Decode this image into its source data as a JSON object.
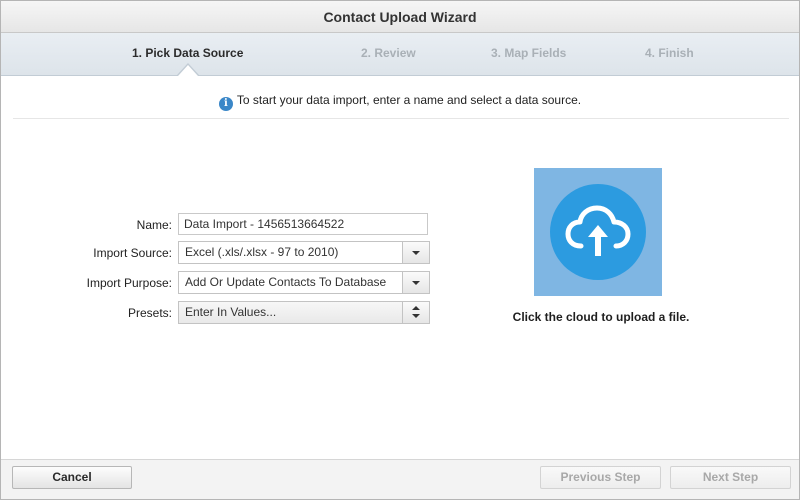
{
  "window": {
    "title": "Contact Upload Wizard"
  },
  "wizard": {
    "steps": [
      {
        "label": "1. Pick Data Source",
        "state": "active"
      },
      {
        "label": "2. Review",
        "state": "inactive"
      },
      {
        "label": "3. Map Fields",
        "state": "inactive"
      },
      {
        "label": "4. Finish",
        "state": "inactive"
      }
    ]
  },
  "info": {
    "icon": "info-icon",
    "text": "To start your data import, enter a name and select a data source."
  },
  "form": {
    "name_label": "Name:",
    "name_value": "Data Import - 1456513664522",
    "source_label": "Import Source:",
    "source_value": "Excel (.xls/.xlsx - 97 to 2010)",
    "purpose_label": "Import Purpose:",
    "purpose_value": "Add Or Update Contacts To Database",
    "presets_label": "Presets:",
    "presets_value": "Enter In Values..."
  },
  "upload": {
    "icon": "cloud-upload-icon",
    "hint": "Click the cloud to upload a file.",
    "colors": {
      "tile": "#7fb6e3",
      "circle": "#2c9be0"
    }
  },
  "footer": {
    "cancel_label": "Cancel",
    "previous_label": "Previous Step",
    "previous_enabled": false,
    "next_label": "Next Step",
    "next_enabled": false
  }
}
